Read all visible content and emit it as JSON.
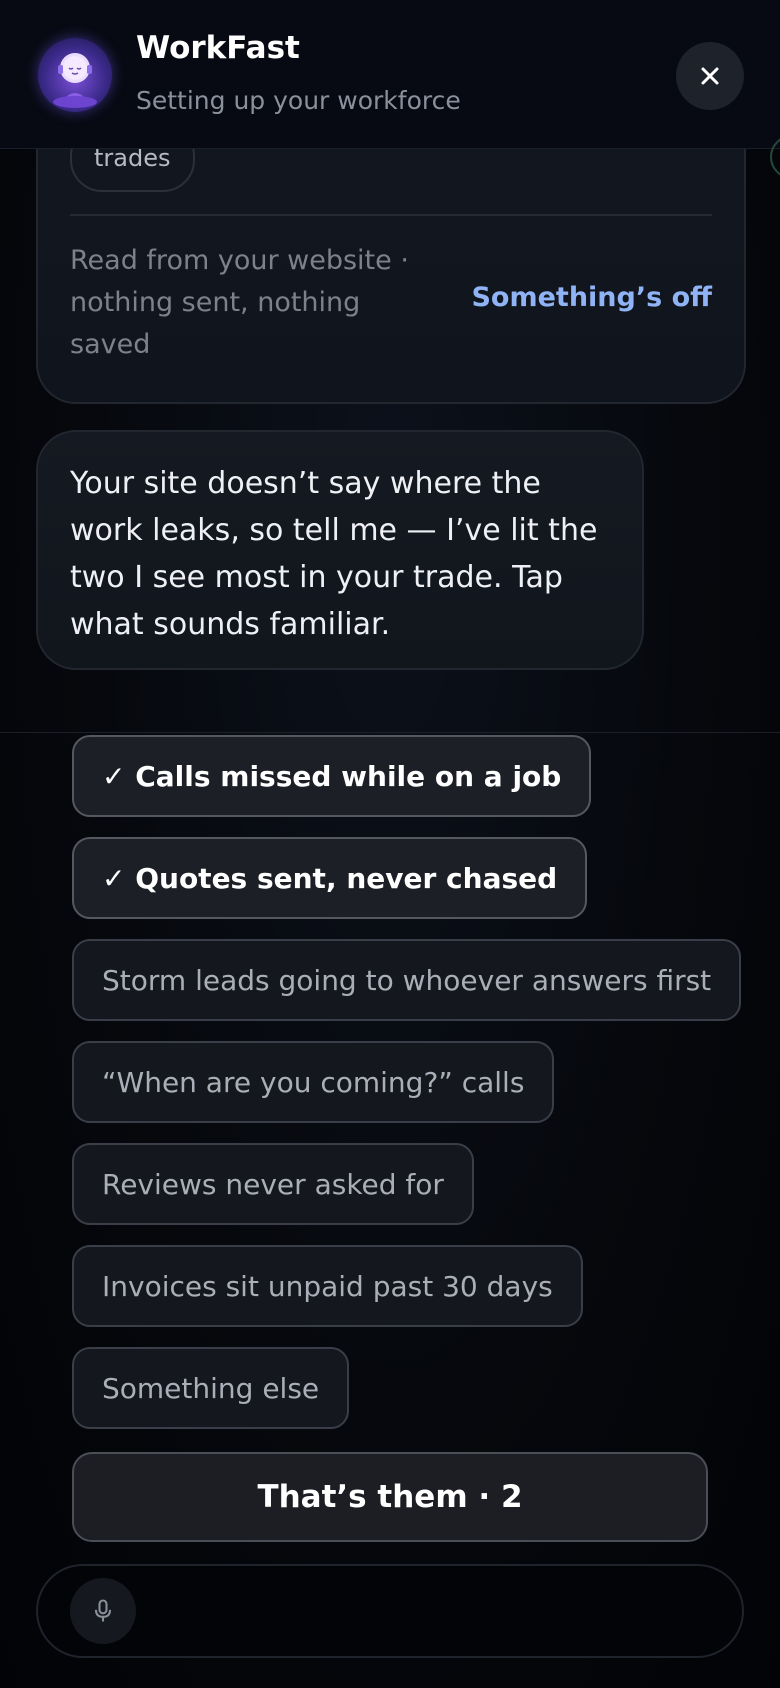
{
  "header": {
    "title": "WorkFast",
    "subtitle": "Setting up your workforce",
    "close_icon": "close-icon",
    "avatar_icon": "meditating-robot-avatar"
  },
  "info_card": {
    "chip": "trades",
    "note": "Read from your website · nothing sent, nothing saved",
    "link": "Something’s off"
  },
  "message": {
    "text": "Your site doesn’t say where the work leaks, so tell me — I’ve lit the two I see most in your trade. Tap what sounds familiar."
  },
  "options": [
    {
      "label": "✓ Calls missed while on a job",
      "selected": true
    },
    {
      "label": "✓ Quotes sent, never chased",
      "selected": true
    },
    {
      "label": "Storm leads going to whoever answers first",
      "selected": false
    },
    {
      "label": "“When are you coming?” calls",
      "selected": false
    },
    {
      "label": "Reviews never asked for",
      "selected": false
    },
    {
      "label": "Invoices sit unpaid past 30 days",
      "selected": false
    },
    {
      "label": "Something else",
      "selected": false
    }
  ],
  "confirm_label": "That’s them · 2",
  "composer": {
    "mic_icon": "microphone-icon"
  },
  "colors": {
    "background": "#05070c",
    "accent_link": "#8fb3f5",
    "selected_text": "#ffffff",
    "unselected_text": "#a9aeb8"
  }
}
